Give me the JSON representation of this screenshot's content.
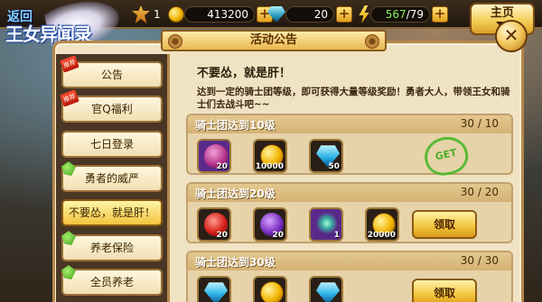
{
  "logo": {
    "line1": "返回",
    "line2": "王女异闻录"
  },
  "topbar": {
    "level": "1",
    "gold": "413200",
    "gems": "20",
    "energy": "567",
    "energy_max": "/79",
    "plus": "+"
  },
  "home": {
    "label": "主页"
  },
  "panel": {
    "title": "活动公告",
    "close": "✕"
  },
  "sidebar": {
    "items": [
      {
        "label": "公告",
        "badge": "推荐"
      },
      {
        "label": "官Q福利",
        "badge": "推荐"
      },
      {
        "label": "七日登录",
        "badge": ""
      },
      {
        "label": "勇者的威严",
        "badge": ""
      },
      {
        "label": "不要怂，就是肝！",
        "badge": ""
      },
      {
        "label": "养老保险",
        "badge": ""
      },
      {
        "label": "全员养老",
        "badge": ""
      }
    ]
  },
  "announcement": {
    "title": "不要怂，就是肝！",
    "description": "达到一定的骑士团等级，即可获得大量等级奖励！勇者大人，带领王女和骑士们去战斗吧~~"
  },
  "tiers": [
    {
      "name": "骑士团达到10级",
      "progress": "30 / 10",
      "status": "claimed",
      "stamp": "GET",
      "rewards": [
        {
          "type": "potion",
          "qty": "20"
        },
        {
          "type": "gold",
          "qty": "10000"
        },
        {
          "type": "gem",
          "qty": "50"
        }
      ]
    },
    {
      "name": "骑士团达到20级",
      "progress": "30 / 20",
      "status": "claimable",
      "button": "领取",
      "rewards": [
        {
          "type": "red-orb",
          "qty": "20"
        },
        {
          "type": "purple-orb",
          "qty": "20"
        },
        {
          "type": "charm",
          "qty": "1"
        },
        {
          "type": "gold",
          "qty": "20000"
        }
      ]
    },
    {
      "name": "骑士团达到30级",
      "progress": "30 / 30",
      "status": "claimable",
      "button": "领取",
      "rewards": [
        {
          "type": "unknown",
          "qty": ""
        },
        {
          "type": "gold",
          "qty": ""
        },
        {
          "type": "gem",
          "qty": ""
        }
      ]
    }
  ]
}
